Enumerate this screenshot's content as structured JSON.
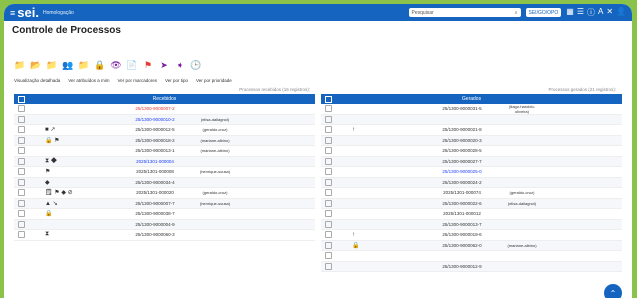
{
  "header": {
    "logo": "sei.",
    "env": "Homologação",
    "search_placeholder": "Pesquisar",
    "unit": "SEI/GO/OPO",
    "icons": [
      "grid-icon",
      "menu-icon",
      "info-icon",
      "font-size-icon",
      "close-icon",
      "user-icon"
    ]
  },
  "page_title": "Controle de Processos",
  "views": [
    "Visualização detalhada",
    "Ver atribuídos a mim",
    "Ver por marcadores",
    "Ver por tipo",
    "Ver por prioridade"
  ],
  "counts": {
    "left": "Processos recebidos (16 registros):",
    "right": "Processos gerados (21 registros):"
  },
  "left": {
    "header": "Recebidos",
    "rows": [
      {
        "num": "25/1300-9000007-2",
        "color": "red",
        "user": "",
        "icons": ""
      },
      {
        "num": "25/1300-9000010-2",
        "color": "blue",
        "user": "(elisa-dallagnol)",
        "icons": ""
      },
      {
        "num": "25/1300-9000012-5",
        "color": "",
        "user": "(geraldo-cruz)",
        "icons": "■ ↗"
      },
      {
        "num": "25/1300-9000018-2",
        "color": "",
        "user": "(mariane-albino)",
        "icons": "🔒 ⚑"
      },
      {
        "num": "25/1300-9000013-1",
        "color": "",
        "user": "(mariane-albino)",
        "icons": ""
      },
      {
        "num": "2025/1301-000004",
        "color": "blue",
        "user": "",
        "icons": "⧗ ◆"
      },
      {
        "num": "2025/1301-000008",
        "color": "",
        "user": "(henrique-sousa)",
        "icons": "⚑"
      },
      {
        "num": "25/1300-9000034-4",
        "color": "",
        "user": "",
        "icons": "◆"
      },
      {
        "num": "2025/1301-000020",
        "color": "",
        "user": "(geraldo-cruz)",
        "icons": "🗒 ⚑ ◆ ⊘"
      },
      {
        "num": "25/1300-9000007-7",
        "color": "",
        "user": "(henrique-sousa)",
        "icons": "▲ ↘"
      },
      {
        "num": "25/1300-9000038-7",
        "color": "",
        "user": "",
        "icons": "🔒"
      },
      {
        "num": "25/1300-9000004-9",
        "color": "",
        "user": "",
        "icons": ""
      },
      {
        "num": "25/1300-9000060-3",
        "color": "",
        "user": "",
        "icons": "⧗"
      }
    ]
  },
  "right": {
    "header": "Gerados",
    "rows": [
      {
        "num": "25/1300-9000031-5",
        "color": "",
        "user": "(tiago-haroldo-oliveira)",
        "icons": ""
      },
      {
        "num": "",
        "color": "",
        "user": "",
        "icons": ""
      },
      {
        "num": "25/1300-9000021-8",
        "color": "",
        "user": "",
        "icons": "↑"
      },
      {
        "num": "25/1300-9000020-3",
        "color": "",
        "user": "",
        "icons": ""
      },
      {
        "num": "25/1300-9000028-5",
        "color": "",
        "user": "",
        "icons": ""
      },
      {
        "num": "25/1300-9000027-7",
        "color": "",
        "user": "",
        "icons": ""
      },
      {
        "num": "25/1300-9000025-0",
        "color": "blue",
        "user": "",
        "icons": ""
      },
      {
        "num": "25/1300-9000024-2",
        "color": "",
        "user": "",
        "icons": ""
      },
      {
        "num": "2025/1301-000074",
        "color": "",
        "user": "(geraldo-cruz)",
        "icons": ""
      },
      {
        "num": "25/1300-9000022-6",
        "color": "",
        "user": "(elisa-dallagnol)",
        "icons": ""
      },
      {
        "num": "2025/1301-000012",
        "color": "",
        "user": "",
        "icons": ""
      },
      {
        "num": "25/1300-9000013-7",
        "color": "",
        "user": "",
        "icons": ""
      },
      {
        "num": "25/1300-9000019-6",
        "color": "",
        "user": "",
        "icons": "↑"
      },
      {
        "num": "25/1300-9000062-0",
        "color": "",
        "user": "(mariane-albino)",
        "icons": "🔒"
      },
      {
        "num": "",
        "color": "",
        "user": "",
        "icons": ""
      },
      {
        "num": "25/1300-9000012-9",
        "color": "",
        "user": "",
        "icons": ""
      }
    ]
  }
}
